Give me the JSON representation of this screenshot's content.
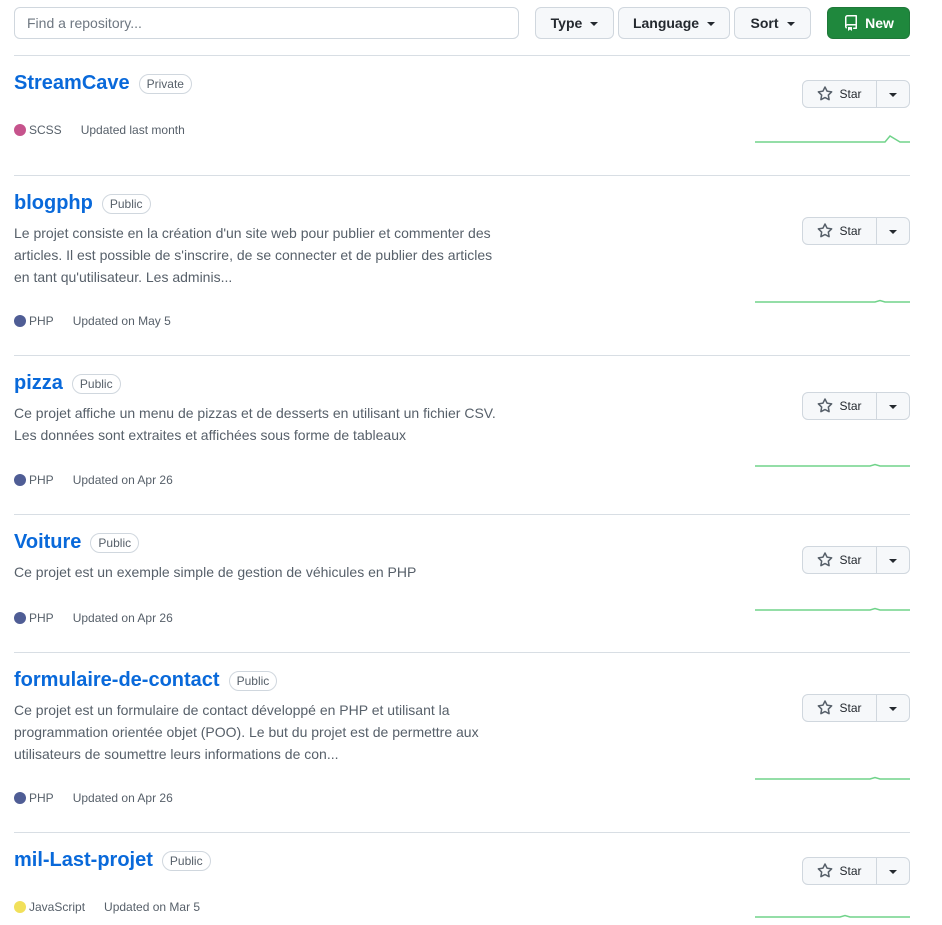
{
  "search": {
    "placeholder": "Find a repository..."
  },
  "filters": {
    "type_label": "Type",
    "language_label": "Language",
    "sort_label": "Sort"
  },
  "new_button": {
    "label": "New"
  },
  "star_label": "Star",
  "languages": {
    "SCSS": "#c6538c",
    "PHP": "#4f5d95",
    "JavaScript": "#f1e05a"
  },
  "repos": [
    {
      "name": "StreamCave",
      "visibility": "Private",
      "description": "",
      "language": "SCSS",
      "updated": "Updated last month"
    },
    {
      "name": "blogphp",
      "visibility": "Public",
      "description": "Le projet consiste en la création d'un site web pour publier et commenter des articles. Il est possible de s'inscrire, de se connecter et de publier des articles en tant qu'utilisateur. Les adminis...",
      "language": "PHP",
      "updated": "Updated on May 5"
    },
    {
      "name": "pizza",
      "visibility": "Public",
      "description": "Ce projet affiche un menu de pizzas et de desserts en utilisant un fichier CSV. Les données sont extraites et affichées sous forme de tableaux",
      "language": "PHP",
      "updated": "Updated on Apr 26"
    },
    {
      "name": "Voiture",
      "visibility": "Public",
      "description": "Ce projet est un exemple simple de gestion de véhicules en PHP",
      "language": "PHP",
      "updated": "Updated on Apr 26"
    },
    {
      "name": "formulaire-de-contact",
      "visibility": "Public",
      "description": "Ce projet est un formulaire de contact développé en PHP et utilisant la programmation orientée objet (POO). Le but du projet est de permettre aux utilisateurs de soumettre leurs informations de con...",
      "language": "PHP",
      "updated": "Updated on Apr 26"
    },
    {
      "name": "mil-Last-projet",
      "visibility": "Public",
      "description": "",
      "language": "JavaScript",
      "updated": "Updated on Mar 5"
    }
  ]
}
